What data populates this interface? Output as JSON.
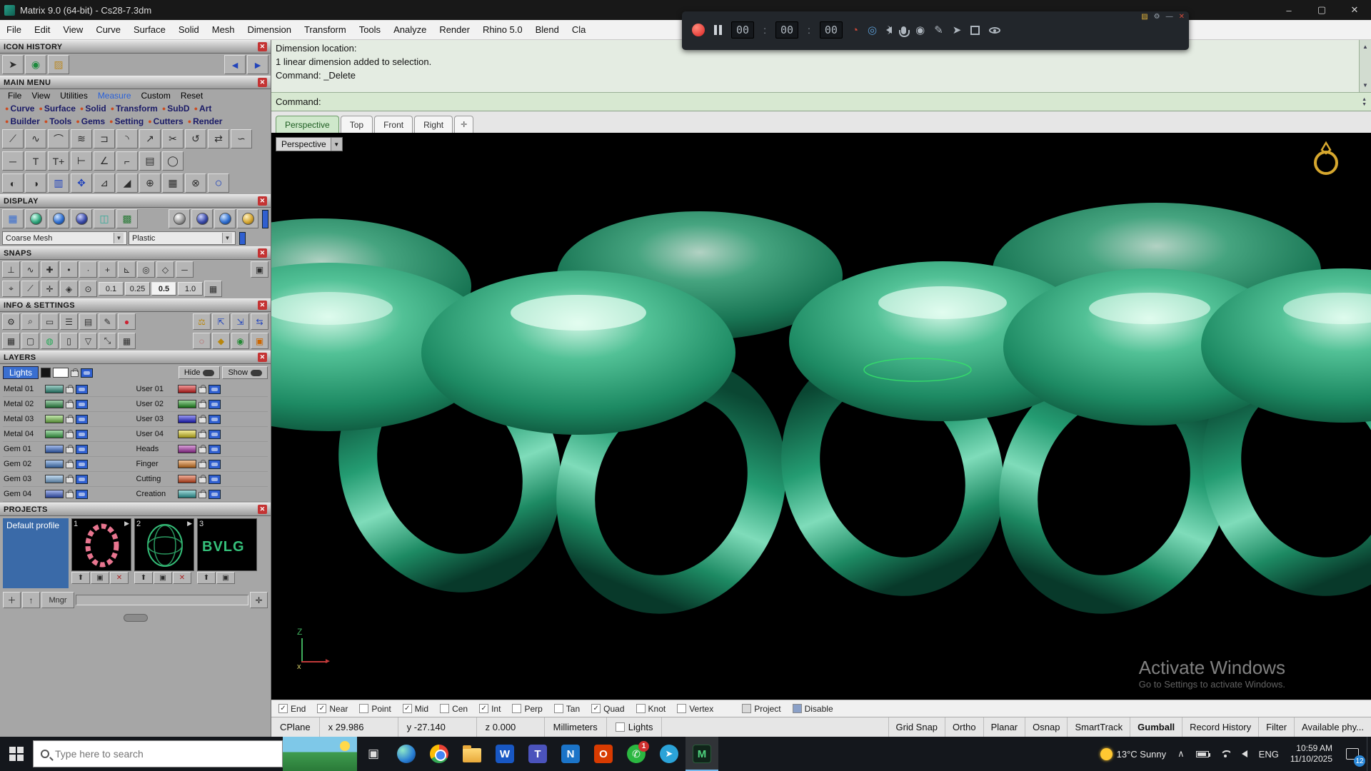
{
  "window": {
    "title": "Matrix 9.0 (64-bit) - Cs28-7.3dm",
    "minimize": "–",
    "maximize": "▢",
    "close": "✕"
  },
  "menubar": {
    "items": [
      "File",
      "Edit",
      "View",
      "Curve",
      "Surface",
      "Solid",
      "Mesh",
      "Dimension",
      "Transform",
      "Tools",
      "Analyze",
      "Render",
      "Rhino 5.0",
      "Blend",
      "Cla"
    ]
  },
  "recorder": {
    "time_h": "00",
    "time_m": "00",
    "time_s": "00"
  },
  "panel": {
    "icon_history_title": "ICON HISTORY",
    "main_menu_title": "MAIN MENU",
    "menu_row1": [
      "File",
      "View",
      "Utilities",
      "Measure",
      "Custom",
      "Reset"
    ],
    "menu_row2": [
      "Curve",
      "Surface",
      "Solid",
      "Transform",
      "SubD",
      "Art"
    ],
    "menu_row3": [
      "Builder",
      "Tools",
      "Gems",
      "Setting",
      "Cutters",
      "Render"
    ],
    "display_title": "DISPLAY",
    "mesh_dropdown": "Coarse Mesh",
    "material_dropdown": "Plastic",
    "snaps_title": "SNAPS",
    "snap_values": [
      "0.1",
      "0.25",
      "0.5",
      "1.0"
    ],
    "info_title": "INFO & SETTINGS",
    "layers_title": "LAYERS",
    "lights_label": "Lights",
    "hide_label": "Hide",
    "show_label": "Show",
    "layers_left": [
      {
        "name": "Metal 01",
        "color": "#2f9a86"
      },
      {
        "name": "Metal 02",
        "color": "#2f9a4a"
      },
      {
        "name": "Metal 03",
        "color": "#7fd14f"
      },
      {
        "name": "Metal 04",
        "color": "#3cb54a"
      },
      {
        "name": "Gem 01",
        "color": "#3a6fd8"
      },
      {
        "name": "Gem 02",
        "color": "#4a86d8"
      },
      {
        "name": "Gem 03",
        "color": "#7fb6e8"
      },
      {
        "name": "Gem 04",
        "color": "#3a5fd8"
      }
    ],
    "layers_right": [
      {
        "name": "User 01",
        "color": "#e82020"
      },
      {
        "name": "User 02",
        "color": "#20a020"
      },
      {
        "name": "User 03",
        "color": "#2020e8"
      },
      {
        "name": "User 04",
        "color": "#e8d820"
      },
      {
        "name": "Heads",
        "color": "#b030b0"
      },
      {
        "name": "Finger",
        "color": "#e88020"
      },
      {
        "name": "Cutting",
        "color": "#e85020"
      },
      {
        "name": "Creation",
        "color": "#30b0b0"
      }
    ],
    "projects_title": "PROJECTS",
    "default_profile": "Default profile",
    "thumb_labels": [
      "1",
      "2",
      "3"
    ],
    "thumb3_text": "BVLG",
    "mngr_label": "Mngr"
  },
  "command": {
    "line1": "Dimension location:",
    "line2": "1 linear dimension added to selection.",
    "line3": "Command: _Delete",
    "prompt": "Command:"
  },
  "viewport": {
    "tabs": [
      "Perspective",
      "Top",
      "Front",
      "Right"
    ],
    "dropdown_label": "Perspective",
    "axis_z": "Z",
    "axis_x": "x",
    "watermark1": "Activate Windows",
    "watermark2": "Go to Settings to activate Windows."
  },
  "osnap": {
    "items": [
      {
        "label": "End",
        "checked": true
      },
      {
        "label": "Near",
        "checked": true
      },
      {
        "label": "Point",
        "checked": false
      },
      {
        "label": "Mid",
        "checked": true
      },
      {
        "label": "Cen",
        "checked": false
      },
      {
        "label": "Int",
        "checked": true
      },
      {
        "label": "Perp",
        "checked": false
      },
      {
        "label": "Tan",
        "checked": false
      },
      {
        "label": "Quad",
        "checked": true
      },
      {
        "label": "Knot",
        "checked": false
      },
      {
        "label": "Vertex",
        "checked": false
      }
    ],
    "project_label": "Project",
    "disable_label": "Disable"
  },
  "statusbar": {
    "cplane": "CPlane",
    "x": "x 29.986",
    "y": "y -27.140",
    "z": "z 0.000",
    "units": "Millimeters",
    "lights": "Lights",
    "panes": [
      "Grid Snap",
      "Ortho",
      "Planar",
      "Osnap",
      "SmartTrack",
      "Gumball",
      "Record History",
      "Filter",
      "Available phy..."
    ]
  },
  "taskbar": {
    "search_placeholder": "Type here to search",
    "weather_temp": "13°C Sunny",
    "lang": "ENG",
    "time": "10:59 AM",
    "date": "11/10/2025",
    "badge": "12",
    "whatsapp_badge": "1",
    "letters": {
      "word": "W",
      "teams": "T",
      "mail": "N",
      "office": "O",
      "matrix": "M",
      "whatsapp": "✆",
      "telegram": "➤"
    }
  }
}
